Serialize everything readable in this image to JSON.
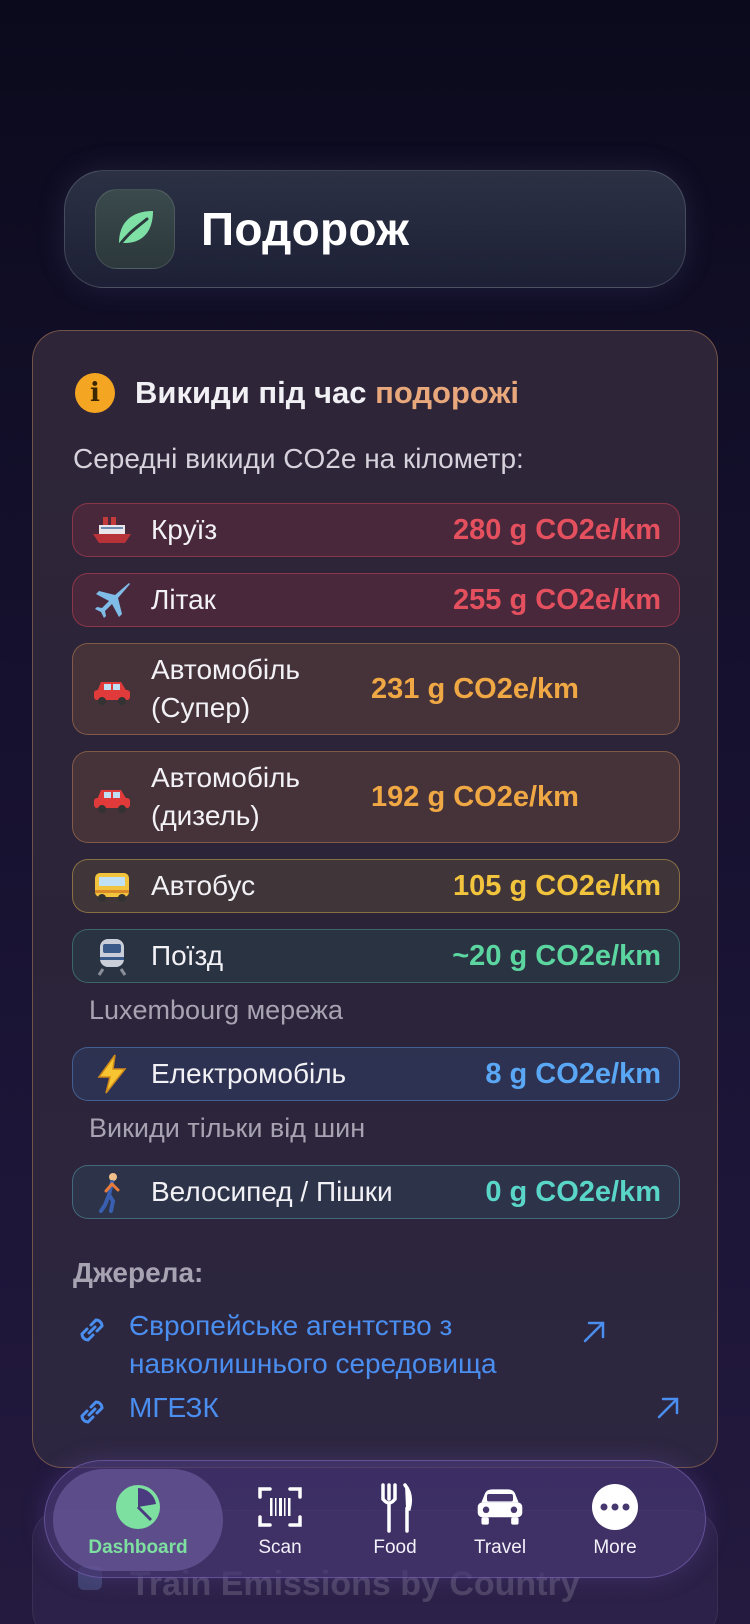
{
  "header": {
    "title": "Подорож",
    "logo_icon": "leaf-icon"
  },
  "card": {
    "title_part1": "Викиди під час",
    "title_part2": "подорожі",
    "subtitle": "Середні викиди CO2e на кілометр:",
    "rows": [
      {
        "icon": "ship-icon",
        "name": "Круїз",
        "value": "280 g CO2e/km",
        "color": "#e5505f"
      },
      {
        "icon": "airplane-icon",
        "name": "Літак",
        "value": "255 g CO2e/km",
        "color": "#e5505f"
      },
      {
        "icon": "car-icon",
        "name": "Автомобіль (Супер)",
        "value": "231 g CO2e/km",
        "color": "#f0a845"
      },
      {
        "icon": "car-icon",
        "name": "Автомобіль (дизель)",
        "value": "192 g CO2e/km",
        "color": "#f0a845"
      },
      {
        "icon": "bus-icon",
        "name": "Автобус",
        "value": "105 g CO2e/km",
        "color": "#f2c33c"
      },
      {
        "icon": "train-icon",
        "name": "Поїзд",
        "value": "~20 g CO2e/km",
        "color": "#5cd6a0",
        "note": "Luxembourg мережа"
      },
      {
        "icon": "lightning-icon",
        "name": "Електромобіль",
        "value": "8 g CO2e/km",
        "color": "#5aa8f5",
        "note": "Викиди тільки від шин"
      },
      {
        "icon": "walking-icon",
        "name": "Велосипед / Пішки",
        "value": "0 g CO2e/km",
        "color": "#5ad6c8"
      }
    ],
    "sources_heading": "Джерела:",
    "sources": [
      {
        "label": "Європейське агентство з навколишнього середовища"
      },
      {
        "label": "МГЕЗК"
      }
    ]
  },
  "behind_card": {
    "title": "Train Emissions by Country"
  },
  "tabbar": {
    "tabs": [
      {
        "label": "Dashboard",
        "icon": "pie-chart-icon",
        "active": true
      },
      {
        "label": "Scan",
        "icon": "barcode-scan-icon"
      },
      {
        "label": "Food",
        "icon": "fork-knife-icon"
      },
      {
        "label": "Travel",
        "icon": "car-front-icon"
      },
      {
        "label": "More",
        "icon": "ellipsis-icon"
      }
    ]
  }
}
